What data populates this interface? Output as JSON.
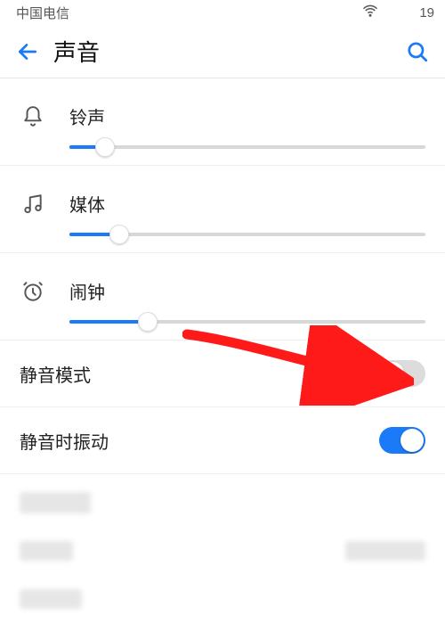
{
  "status": {
    "carrier": "中国电信",
    "time_fragment": "19"
  },
  "header": {
    "title": "声音"
  },
  "sliders": [
    {
      "label": "铃声",
      "icon": "bell",
      "value_percent": 10
    },
    {
      "label": "媒体",
      "icon": "music",
      "value_percent": 14
    },
    {
      "label": "闹钟",
      "icon": "clock",
      "value_percent": 22
    }
  ],
  "toggles": [
    {
      "label": "静音模式",
      "state": "off"
    },
    {
      "label": "静音时振动",
      "state": "on"
    }
  ],
  "colors": {
    "accent": "#1a7af8",
    "arrow": "#ff1a1a"
  }
}
